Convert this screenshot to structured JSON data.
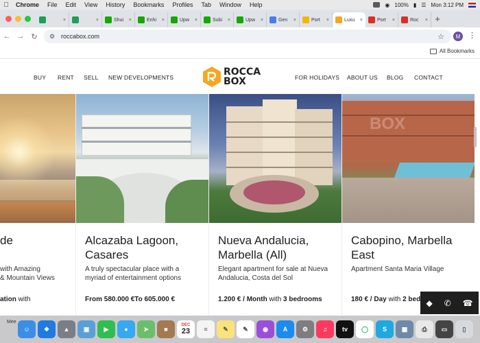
{
  "menubar": {
    "app": "Chrome",
    "items": [
      "File",
      "Edit",
      "View",
      "History",
      "Bookmarks",
      "Profiles",
      "Tab",
      "Window",
      "Help"
    ],
    "battery": "100%",
    "clock": "Mon 3:12 PM"
  },
  "tabs": [
    {
      "label": "",
      "icon": "sheets-icon",
      "color": "#1e9e5a"
    },
    {
      "label": "",
      "icon": "sheets-icon",
      "color": "#1e9e5a"
    },
    {
      "label": "Shui",
      "icon": "upwork-icon",
      "color": "#14a800"
    },
    {
      "label": "Enhi",
      "icon": "upwork-icon",
      "color": "#14a800"
    },
    {
      "label": "Upw",
      "icon": "upwork-icon",
      "color": "#14a800"
    },
    {
      "label": "Subi",
      "icon": "upwork-icon",
      "color": "#14a800"
    },
    {
      "label": "Upw",
      "icon": "upwork-icon",
      "color": "#14a800"
    },
    {
      "label": "Gen",
      "icon": "gemini-icon",
      "color": "#4b7bec"
    },
    {
      "label": "Port",
      "icon": "drive-icon",
      "color": "#f4b400"
    },
    {
      "label": "Luxu",
      "icon": "roccabox-icon",
      "color": "#f5a623",
      "active": true
    },
    {
      "label": "Port",
      "icon": "arc-icon",
      "color": "#d93025"
    },
    {
      "label": "Roc",
      "icon": "arc-icon",
      "color": "#d93025"
    }
  ],
  "toolbar": {
    "url": "roccabox.com"
  },
  "profile_initial": "M",
  "bookmarks": {
    "all_label": "All Bookmarks"
  },
  "site": {
    "nav_left": [
      "BUY",
      "RENT",
      "SELL",
      "NEW DEVELOPMENTS"
    ],
    "nav_right": [
      "FOR HOLIDAYS",
      "ABOUT US",
      "BLOG",
      "CONTACT"
    ],
    "logo_line1": "ROCCA",
    "logo_line2": "BOX",
    "brand_color": "#f5a623"
  },
  "cards": [
    {
      "title": "de",
      "desc": "with Amazing\n& Mountain Views",
      "price_bold": "ation",
      "price_rest": " with"
    },
    {
      "title": "Alcazaba Lagoon,\nCasares",
      "desc": "A truly spectacular place with a\nmyriad of entertainment options",
      "price_bold": "From 580.000 €To 605.000 €",
      "price_rest": ""
    },
    {
      "title": "Nueva Andalucia,\nMarbella (All)",
      "desc": "Elegant apartment for sale at Nueva\nAndalucia, Costa del Sol",
      "price_bold": "1.200 € / Month",
      "price_rest": " with ",
      "price_bold2": "3 bedrooms"
    },
    {
      "title": "Cabopino, Marbella\nEast",
      "desc": "Apartment Santa Maria Village",
      "price_bold": "180 € / Day",
      "price_rest": " with ",
      "price_bold2": "2 bedr"
    }
  ],
  "watermark": "BOX",
  "dock": {
    "label": "Mee",
    "calendar_month": "DEC",
    "calendar_day": "23"
  }
}
